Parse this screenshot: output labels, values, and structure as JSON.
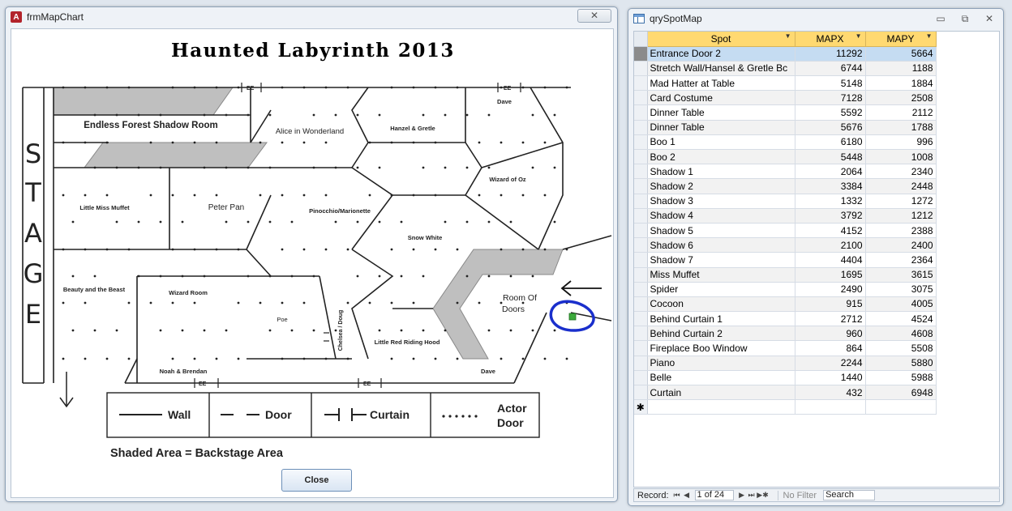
{
  "form_window": {
    "title": "frmMapChart",
    "close_x": "✕",
    "close_button": "Close",
    "map": {
      "title": "Haunted Labyrinth 2013",
      "stage_letters": [
        "S",
        "T",
        "A",
        "G",
        "E"
      ],
      "rooms": [
        {
          "label": "Endless Forest Shadow Room"
        },
        {
          "label": "Alice in Wonderland"
        },
        {
          "label": "Hanzel & Gretle"
        },
        {
          "label": "Dave"
        },
        {
          "label": "Wizard of Oz"
        },
        {
          "label": "Little Miss Muffet"
        },
        {
          "label": "Peter Pan"
        },
        {
          "label": "Pinocchio/Marionette"
        },
        {
          "label": "Snow White"
        },
        {
          "label": "Beauty and the Beast"
        },
        {
          "label": "Wizard Room"
        },
        {
          "label": "Poe"
        },
        {
          "label": "Chelsea / Doug"
        },
        {
          "label": "Little Red Riding Hood"
        },
        {
          "label": "Room Of"
        },
        {
          "label": "Doors"
        },
        {
          "label": "Noah & Brendan"
        },
        {
          "label": "Dave"
        }
      ],
      "exit_marks": [
        "EE",
        "EE",
        "EE",
        "EE"
      ],
      "legend": {
        "wall": "Wall",
        "door": "Door",
        "curtain": "Curtain",
        "actor_door_1": "Actor",
        "actor_door_2": "Door"
      },
      "shaded_note": "Shaded Area = Backstage Area"
    }
  },
  "query_window": {
    "title": "qrySpotMap",
    "controls": {
      "minimize": "▭",
      "restore": "⧉",
      "close": "✕"
    },
    "columns": [
      "Spot",
      "MAPX",
      "MAPY"
    ],
    "rows": [
      {
        "spot": "Entrance Door 2",
        "mapx": "11292",
        "mapy": "5664"
      },
      {
        "spot": "Stretch Wall/Hansel & Gretle Bc",
        "mapx": "6744",
        "mapy": "1188"
      },
      {
        "spot": "Mad Hatter at Table",
        "mapx": "5148",
        "mapy": "1884"
      },
      {
        "spot": "Card Costume",
        "mapx": "7128",
        "mapy": "2508"
      },
      {
        "spot": "Dinner Table",
        "mapx": "5592",
        "mapy": "2112"
      },
      {
        "spot": "Dinner Table",
        "mapx": "5676",
        "mapy": "1788"
      },
      {
        "spot": "Boo 1",
        "mapx": "6180",
        "mapy": "996"
      },
      {
        "spot": "Boo 2",
        "mapx": "5448",
        "mapy": "1008"
      },
      {
        "spot": "Shadow 1",
        "mapx": "2064",
        "mapy": "2340"
      },
      {
        "spot": "Shadow 2",
        "mapx": "3384",
        "mapy": "2448"
      },
      {
        "spot": "Shadow 3",
        "mapx": "1332",
        "mapy": "1272"
      },
      {
        "spot": "Shadow 4",
        "mapx": "3792",
        "mapy": "1212"
      },
      {
        "spot": "Shadow 5",
        "mapx": "4152",
        "mapy": "2388"
      },
      {
        "spot": "Shadow 6",
        "mapx": "2100",
        "mapy": "2400"
      },
      {
        "spot": "Shadow 7",
        "mapx": "4404",
        "mapy": "2364"
      },
      {
        "spot": "Miss Muffet",
        "mapx": "1695",
        "mapy": "3615"
      },
      {
        "spot": "Spider",
        "mapx": "2490",
        "mapy": "3075"
      },
      {
        "spot": "Cocoon",
        "mapx": "915",
        "mapy": "4005"
      },
      {
        "spot": "Behind Curtain 1",
        "mapx": "2712",
        "mapy": "4524"
      },
      {
        "spot": "Behind Curtain 2",
        "mapx": "960",
        "mapy": "4608"
      },
      {
        "spot": "Fireplace Boo Window",
        "mapx": "864",
        "mapy": "5508"
      },
      {
        "spot": "Piano",
        "mapx": "2244",
        "mapy": "5880"
      },
      {
        "spot": "Belle",
        "mapx": "1440",
        "mapy": "5988"
      },
      {
        "spot": "Curtain",
        "mapx": "432",
        "mapy": "6948"
      }
    ],
    "new_row_marker": "✱",
    "nav": {
      "label": "Record:",
      "first": "⏮",
      "prev": "◀",
      "position": "1 of 24",
      "next": "▶",
      "last": "⏭",
      "new": "▶✱",
      "filter": "No Filter",
      "search": "Search"
    }
  }
}
